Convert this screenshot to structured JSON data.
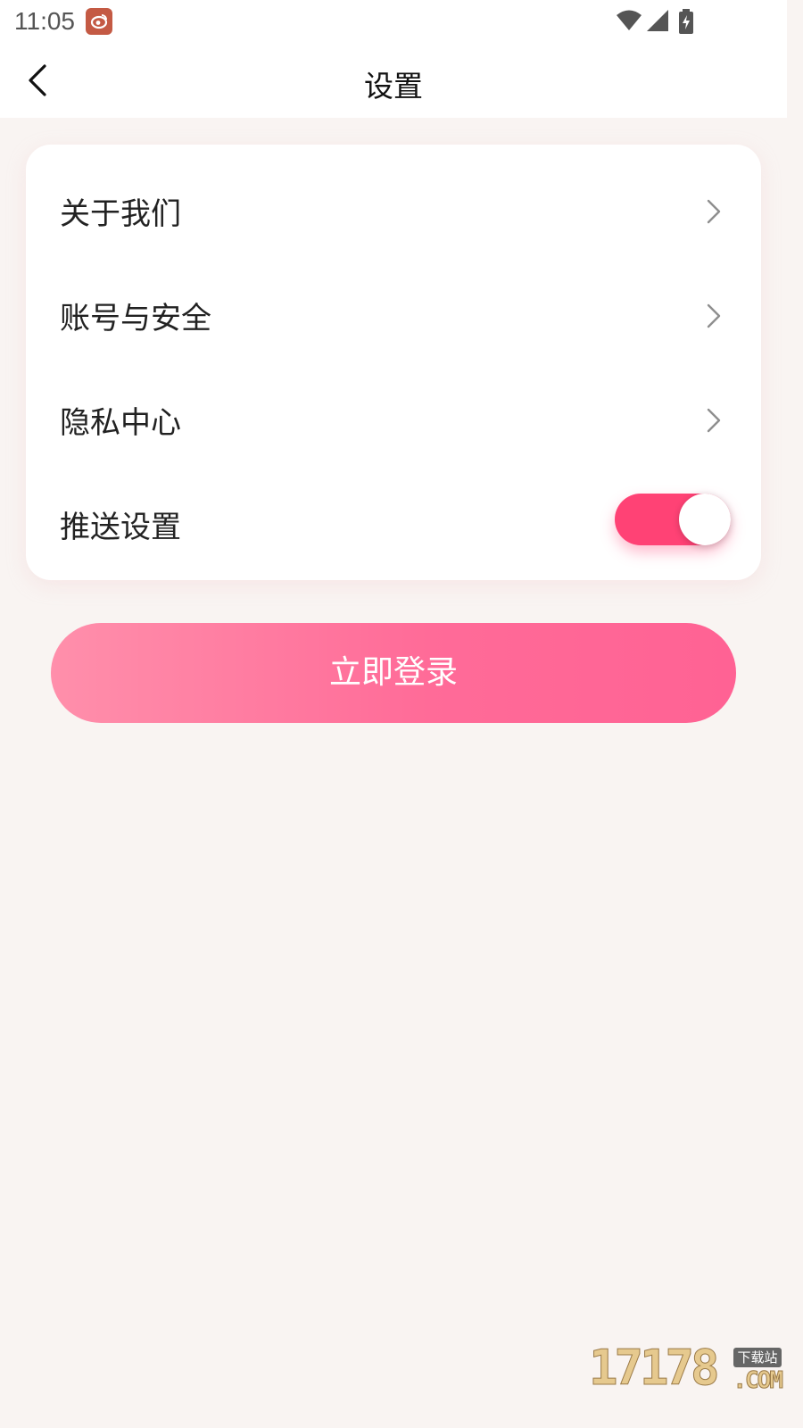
{
  "status_bar": {
    "time": "11:05",
    "app_icon": "weibo-icon",
    "icons": [
      "wifi-icon",
      "signal-icon",
      "battery-charging-icon"
    ]
  },
  "nav": {
    "back_icon": "chevron-left-icon",
    "title": "设置"
  },
  "settings": {
    "items": [
      {
        "label": "关于我们",
        "icon": "chevron-right-icon"
      },
      {
        "label": "账号与安全",
        "icon": "chevron-right-icon"
      },
      {
        "label": "隐私中心",
        "icon": "chevron-right-icon"
      },
      {
        "label": "推送设置",
        "toggle_on": true
      }
    ]
  },
  "login_button": {
    "label": "立即登录"
  },
  "watermark": {
    "number": "17178",
    "tag": "下载站",
    "domain": ".COM"
  },
  "colors": {
    "background": "#f9f4f2",
    "card": "#ffffff",
    "toggle_on": "#ff4275",
    "button_gradient_start": "#ff8fab",
    "button_gradient_end": "#ff6294",
    "chevron": "#8e8e8e"
  }
}
